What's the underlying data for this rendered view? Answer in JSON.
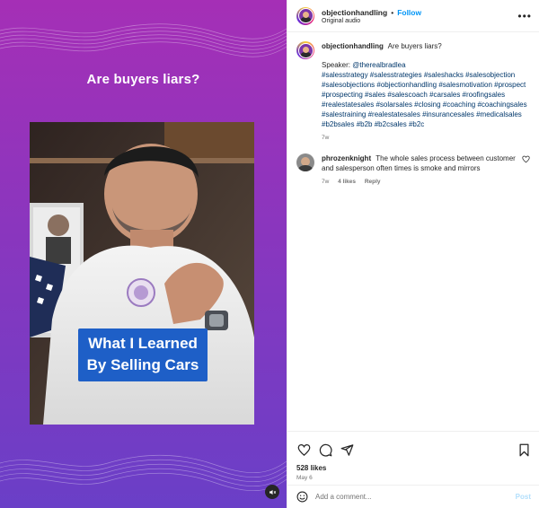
{
  "media": {
    "title": "Are buyers liars?",
    "video_caption_line1": "What I Learned",
    "video_caption_line2": "By Selling Cars"
  },
  "header": {
    "username": "objectionhandling",
    "dot": "•",
    "follow_label": "Follow",
    "audio_label": "Original audio",
    "more_label": "•••"
  },
  "caption": {
    "username": "objectionhandling",
    "text": "Are buyers liars?",
    "speaker_prefix": "Speaker: ",
    "speaker_handle": "@therealbradlea",
    "hashtag_lines": [
      "#salesstrategy #salesstrategies #saleshacks #salesobjection",
      "#salesobjections #objectionhandling #salesmotivation #prospect",
      "#prospecting #sales #salescoach #carsales #roofingsales",
      "#realestatesales #solarsales #closing #coaching #coachingsales",
      "#salestraining #realestatesales #insurancesales #medicalsales",
      "#b2bsales #b2b #b2csales #b2c"
    ],
    "time": "7w"
  },
  "comment": {
    "username": "phrozenknight",
    "text": "The whole sales process between customer and salesperson often times is smoke and mirrors",
    "time": "7w",
    "likes": "4 likes",
    "reply": "Reply"
  },
  "actions": {
    "likes_count": "528 likes",
    "date": "May 6"
  },
  "add_comment": {
    "placeholder": "Add a comment...",
    "post_label": "Post"
  },
  "colors": {
    "accent_blue": "#0095f6",
    "link_blue": "#00376b",
    "media_gradient_top": "#a52fb6",
    "media_gradient_bottom": "#6a3fc7",
    "caption_box": "#1e5fc7"
  },
  "icons": [
    "heart-icon",
    "comment-icon",
    "share-icon",
    "bookmark-icon",
    "emoji-icon",
    "more-icon",
    "mute-icon"
  ]
}
